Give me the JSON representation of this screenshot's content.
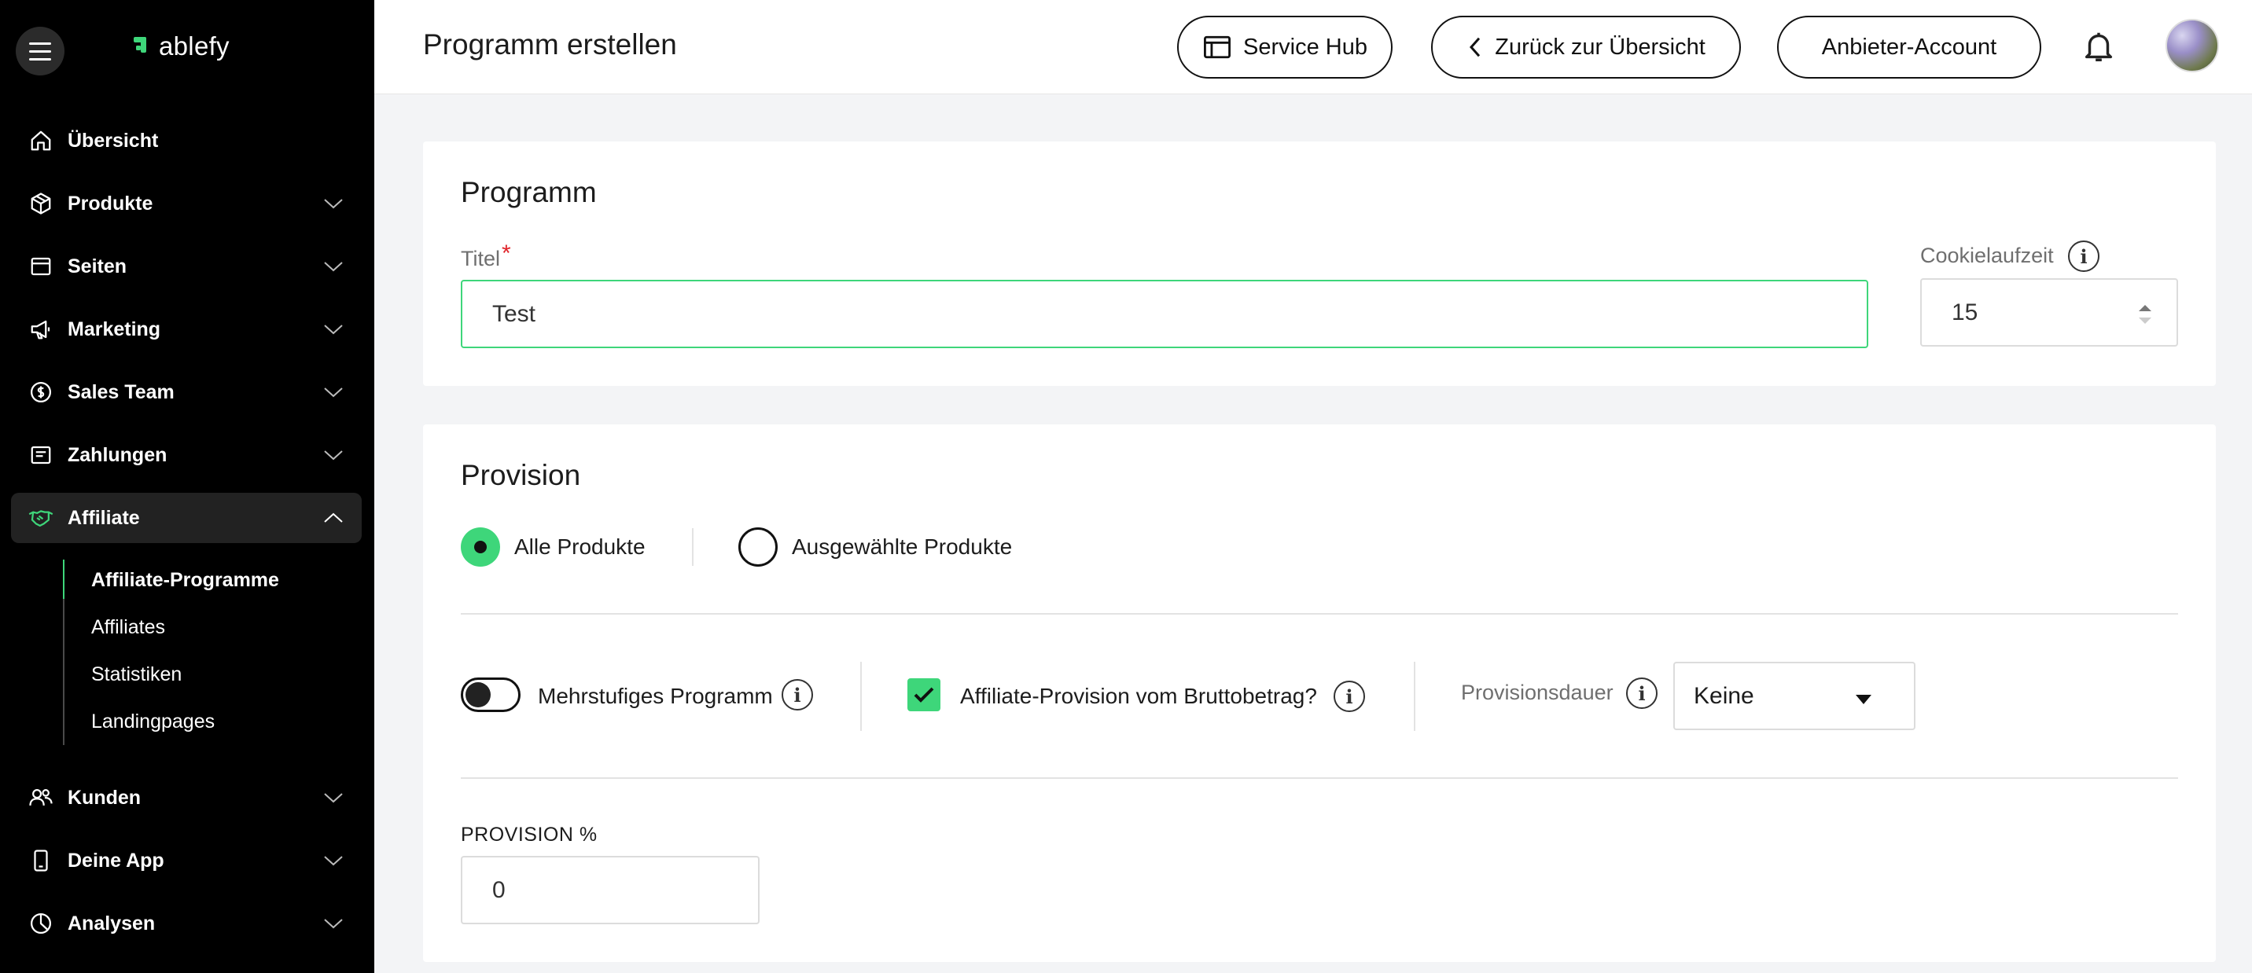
{
  "brand": {
    "name": "ablefy",
    "accent": "#3ed67a"
  },
  "sidebar": {
    "items": [
      {
        "label": "Übersicht",
        "icon": "home-icon"
      },
      {
        "label": "Produkte",
        "icon": "cube-icon"
      },
      {
        "label": "Seiten",
        "icon": "page-icon"
      },
      {
        "label": "Marketing",
        "icon": "megaphone-icon"
      },
      {
        "label": "Sales Team",
        "icon": "coin-icon"
      },
      {
        "label": "Zahlungen",
        "icon": "receipt-icon"
      },
      {
        "label": "Affiliate",
        "icon": "handshake-icon",
        "active": true
      },
      {
        "label": "Kunden",
        "icon": "users-icon"
      },
      {
        "label": "Deine App",
        "icon": "phone-icon"
      },
      {
        "label": "Analysen",
        "icon": "pie-icon"
      }
    ],
    "affiliate_sub": [
      {
        "label": "Affiliate-Programme",
        "active": true
      },
      {
        "label": "Affiliates"
      },
      {
        "label": "Statistiken"
      },
      {
        "label": "Landingpages"
      }
    ]
  },
  "header": {
    "title": "Programm erstellen",
    "service_hub": "Service Hub",
    "back": "Zurück zur Übersicht",
    "account": "Anbieter-Account"
  },
  "programm": {
    "title": "Programm",
    "titel_label": "Titel",
    "required_mark": "*",
    "titel_value": "Test",
    "cookie_label": "Cookielaufzeit",
    "cookie_value": "15"
  },
  "provision": {
    "title": "Provision",
    "radio_all": "Alle Produkte",
    "radio_selected": "Ausgewählte Produkte",
    "multi_level": "Mehrstufiges Programm",
    "multi_level_on": false,
    "gross": "Affiliate-Provision vom Bruttobetrag?",
    "gross_checked": true,
    "duration_label": "Provisionsdauer",
    "duration_value": "Keine",
    "percent_label": "PROVISION %",
    "percent_value": "0"
  }
}
